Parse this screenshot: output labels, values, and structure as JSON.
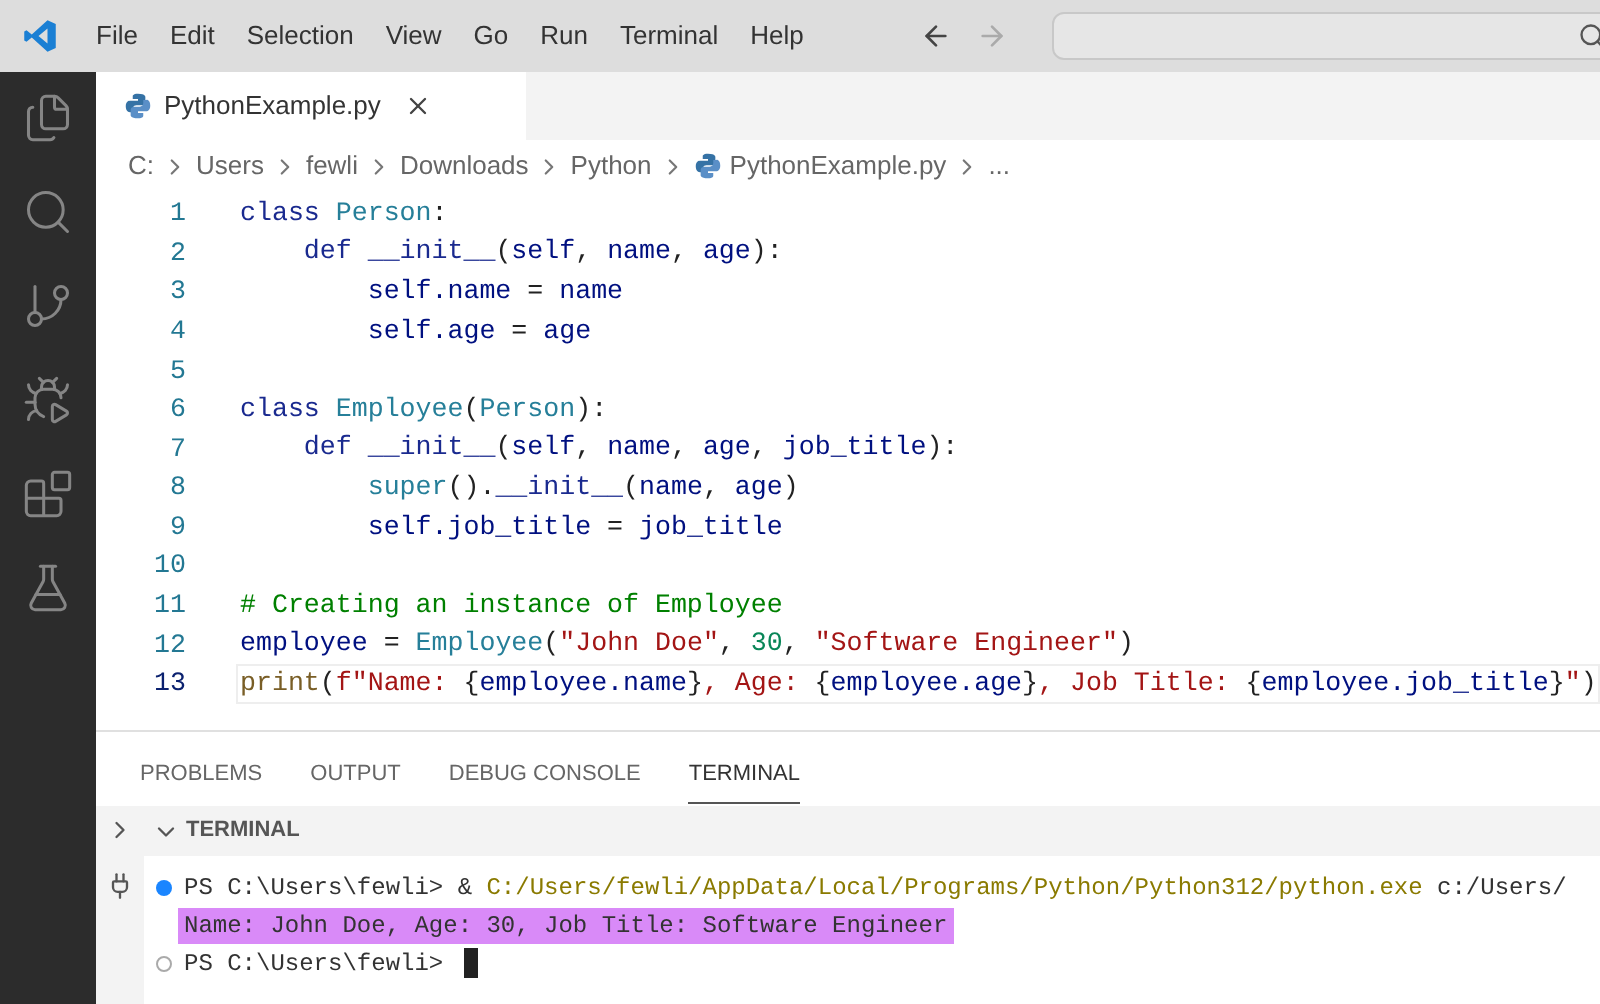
{
  "menu": [
    {
      "label": "File"
    },
    {
      "label": "Edit"
    },
    {
      "label": "Selection"
    },
    {
      "label": "View"
    },
    {
      "label": "Go"
    },
    {
      "label": "Run"
    },
    {
      "label": "Terminal"
    },
    {
      "label": "Help"
    }
  ],
  "nav": {
    "back_disabled": false,
    "forward_disabled": true
  },
  "editor_tabs": [
    {
      "label": "PythonExample.py",
      "selected": true
    }
  ],
  "breadcrumbs": [
    {
      "kind": "folder",
      "label": "C:"
    },
    {
      "kind": "folder",
      "label": "Users"
    },
    {
      "kind": "folder",
      "label": "fewli"
    },
    {
      "kind": "folder",
      "label": "Downloads"
    },
    {
      "kind": "folder",
      "label": "Python"
    },
    {
      "kind": "file",
      "label": "PythonExample.py"
    },
    {
      "kind": "more",
      "label": "..."
    }
  ],
  "code": [
    {
      "number": "1",
      "current": false,
      "tokens": [
        {
          "kind": "keyword",
          "text": "class "
        },
        {
          "kind": "type",
          "text": "Person"
        },
        {
          "kind": "plain",
          "text": ":"
        }
      ]
    },
    {
      "number": "2",
      "current": false,
      "tokens": [
        {
          "kind": "keyword",
          "text": "    def "
        },
        {
          "kind": "keyword",
          "text": "__init__"
        },
        {
          "kind": "plain",
          "text": "("
        },
        {
          "kind": "variable",
          "text": "self"
        },
        {
          "kind": "plain",
          "text": ", "
        },
        {
          "kind": "variable",
          "text": "name"
        },
        {
          "kind": "plain",
          "text": ", "
        },
        {
          "kind": "variable",
          "text": "age"
        },
        {
          "kind": "plain",
          "text": "):"
        }
      ]
    },
    {
      "number": "3",
      "current": false,
      "tokens": [
        {
          "kind": "variable",
          "text": "        self.name"
        },
        {
          "kind": "plain",
          "text": " = "
        },
        {
          "kind": "variable",
          "text": "name"
        }
      ]
    },
    {
      "number": "4",
      "current": false,
      "tokens": [
        {
          "kind": "variable",
          "text": "        self.age"
        },
        {
          "kind": "plain",
          "text": " = "
        },
        {
          "kind": "variable",
          "text": "age"
        }
      ]
    },
    {
      "number": "5",
      "current": false
    },
    {
      "number": "6",
      "current": false,
      "tokens": [
        {
          "kind": "keyword",
          "text": "class "
        },
        {
          "kind": "type",
          "text": "Employee"
        },
        {
          "kind": "plain",
          "text": "("
        },
        {
          "kind": "type",
          "text": "Person"
        },
        {
          "kind": "plain",
          "text": "):"
        }
      ]
    },
    {
      "number": "7",
      "current": false,
      "tokens": [
        {
          "kind": "keyword",
          "text": "    def "
        },
        {
          "kind": "keyword",
          "text": "__init__"
        },
        {
          "kind": "plain",
          "text": "("
        },
        {
          "kind": "variable",
          "text": "self"
        },
        {
          "kind": "plain",
          "text": ", "
        },
        {
          "kind": "variable",
          "text": "name"
        },
        {
          "kind": "plain",
          "text": ", "
        },
        {
          "kind": "variable",
          "text": "age"
        },
        {
          "kind": "plain",
          "text": ", "
        },
        {
          "kind": "variable",
          "text": "job_title"
        },
        {
          "kind": "plain",
          "text": "):"
        }
      ]
    },
    {
      "number": "8",
      "current": false,
      "tokens": [
        {
          "kind": "type",
          "text": "        super"
        },
        {
          "kind": "plain",
          "text": "()."
        },
        {
          "kind": "keyword",
          "text": "__init__"
        },
        {
          "kind": "plain",
          "text": "("
        },
        {
          "kind": "variable",
          "text": "name"
        },
        {
          "kind": "plain",
          "text": ", "
        },
        {
          "kind": "variable",
          "text": "age"
        },
        {
          "kind": "plain",
          "text": ")"
        }
      ]
    },
    {
      "number": "9",
      "current": false,
      "tokens": [
        {
          "kind": "variable",
          "text": "        self.job_title"
        },
        {
          "kind": "plain",
          "text": " = "
        },
        {
          "kind": "variable",
          "text": "job_title"
        }
      ]
    },
    {
      "number": "10",
      "current": false
    },
    {
      "number": "11",
      "current": false,
      "tokens": [
        {
          "kind": "comment",
          "text": "# Creating an instance of Employee"
        }
      ]
    },
    {
      "number": "12",
      "current": false,
      "tokens": [
        {
          "kind": "variable",
          "text": "employee"
        },
        {
          "kind": "plain",
          "text": " = "
        },
        {
          "kind": "type",
          "text": "Employee"
        },
        {
          "kind": "plain",
          "text": "("
        },
        {
          "kind": "string",
          "text": "\"John Doe\""
        },
        {
          "kind": "plain",
          "text": ", "
        },
        {
          "kind": "number",
          "text": "30"
        },
        {
          "kind": "plain",
          "text": ", "
        },
        {
          "kind": "string",
          "text": "\"Software Engineer\""
        },
        {
          "kind": "plain",
          "text": ")"
        }
      ]
    },
    {
      "number": "13",
      "current": true,
      "tokens": [
        {
          "kind": "function",
          "text": "print"
        },
        {
          "kind": "plain",
          "text": "("
        },
        {
          "kind": "string",
          "text": "f\"Name: "
        },
        {
          "kind": "plain",
          "text": "{"
        },
        {
          "kind": "variable",
          "text": "employee.name"
        },
        {
          "kind": "plain",
          "text": "}"
        },
        {
          "kind": "string",
          "text": ", Age: "
        },
        {
          "kind": "plain",
          "text": "{"
        },
        {
          "kind": "variable",
          "text": "employee.age"
        },
        {
          "kind": "plain",
          "text": "}"
        },
        {
          "kind": "string",
          "text": ", Job Title: "
        },
        {
          "kind": "plain",
          "text": "{"
        },
        {
          "kind": "variable",
          "text": "employee.job_title"
        },
        {
          "kind": "plain",
          "text": "}"
        },
        {
          "kind": "string",
          "text": "\""
        },
        {
          "kind": "plain",
          "text": ")"
        }
      ]
    }
  ],
  "panel_tabs": [
    {
      "label": "PROBLEMS",
      "selected": false
    },
    {
      "label": "OUTPUT",
      "selected": false
    },
    {
      "label": "DEBUG CONSOLE",
      "selected": false
    },
    {
      "label": "TERMINAL",
      "selected": true
    }
  ],
  "terminal": {
    "section_title": "TERMINAL",
    "expanded": true,
    "lines": [
      {
        "has_marker": true,
        "marker_filled": true,
        "highlighted": false,
        "cursor": false,
        "segments": [
          {
            "kind": "plain",
            "text": "PS C:\\Users\\fewli> & "
          },
          {
            "kind": "path",
            "text": "C:/Users/fewli/AppData/Local/Programs/Python/Python312/python.exe"
          },
          {
            "kind": "plain",
            "text": " c:/Users/"
          }
        ]
      },
      {
        "has_marker": false,
        "highlighted": true,
        "cursor": false,
        "segments": [
          {
            "kind": "plain",
            "text": "Name: John Doe, Age: 30, Job Title: Software Engineer"
          }
        ]
      },
      {
        "has_marker": true,
        "marker_filled": false,
        "highlighted": false,
        "cursor": true,
        "segments": [
          {
            "kind": "plain",
            "text": "PS C:\\Users\\fewli> "
          }
        ]
      }
    ]
  }
}
